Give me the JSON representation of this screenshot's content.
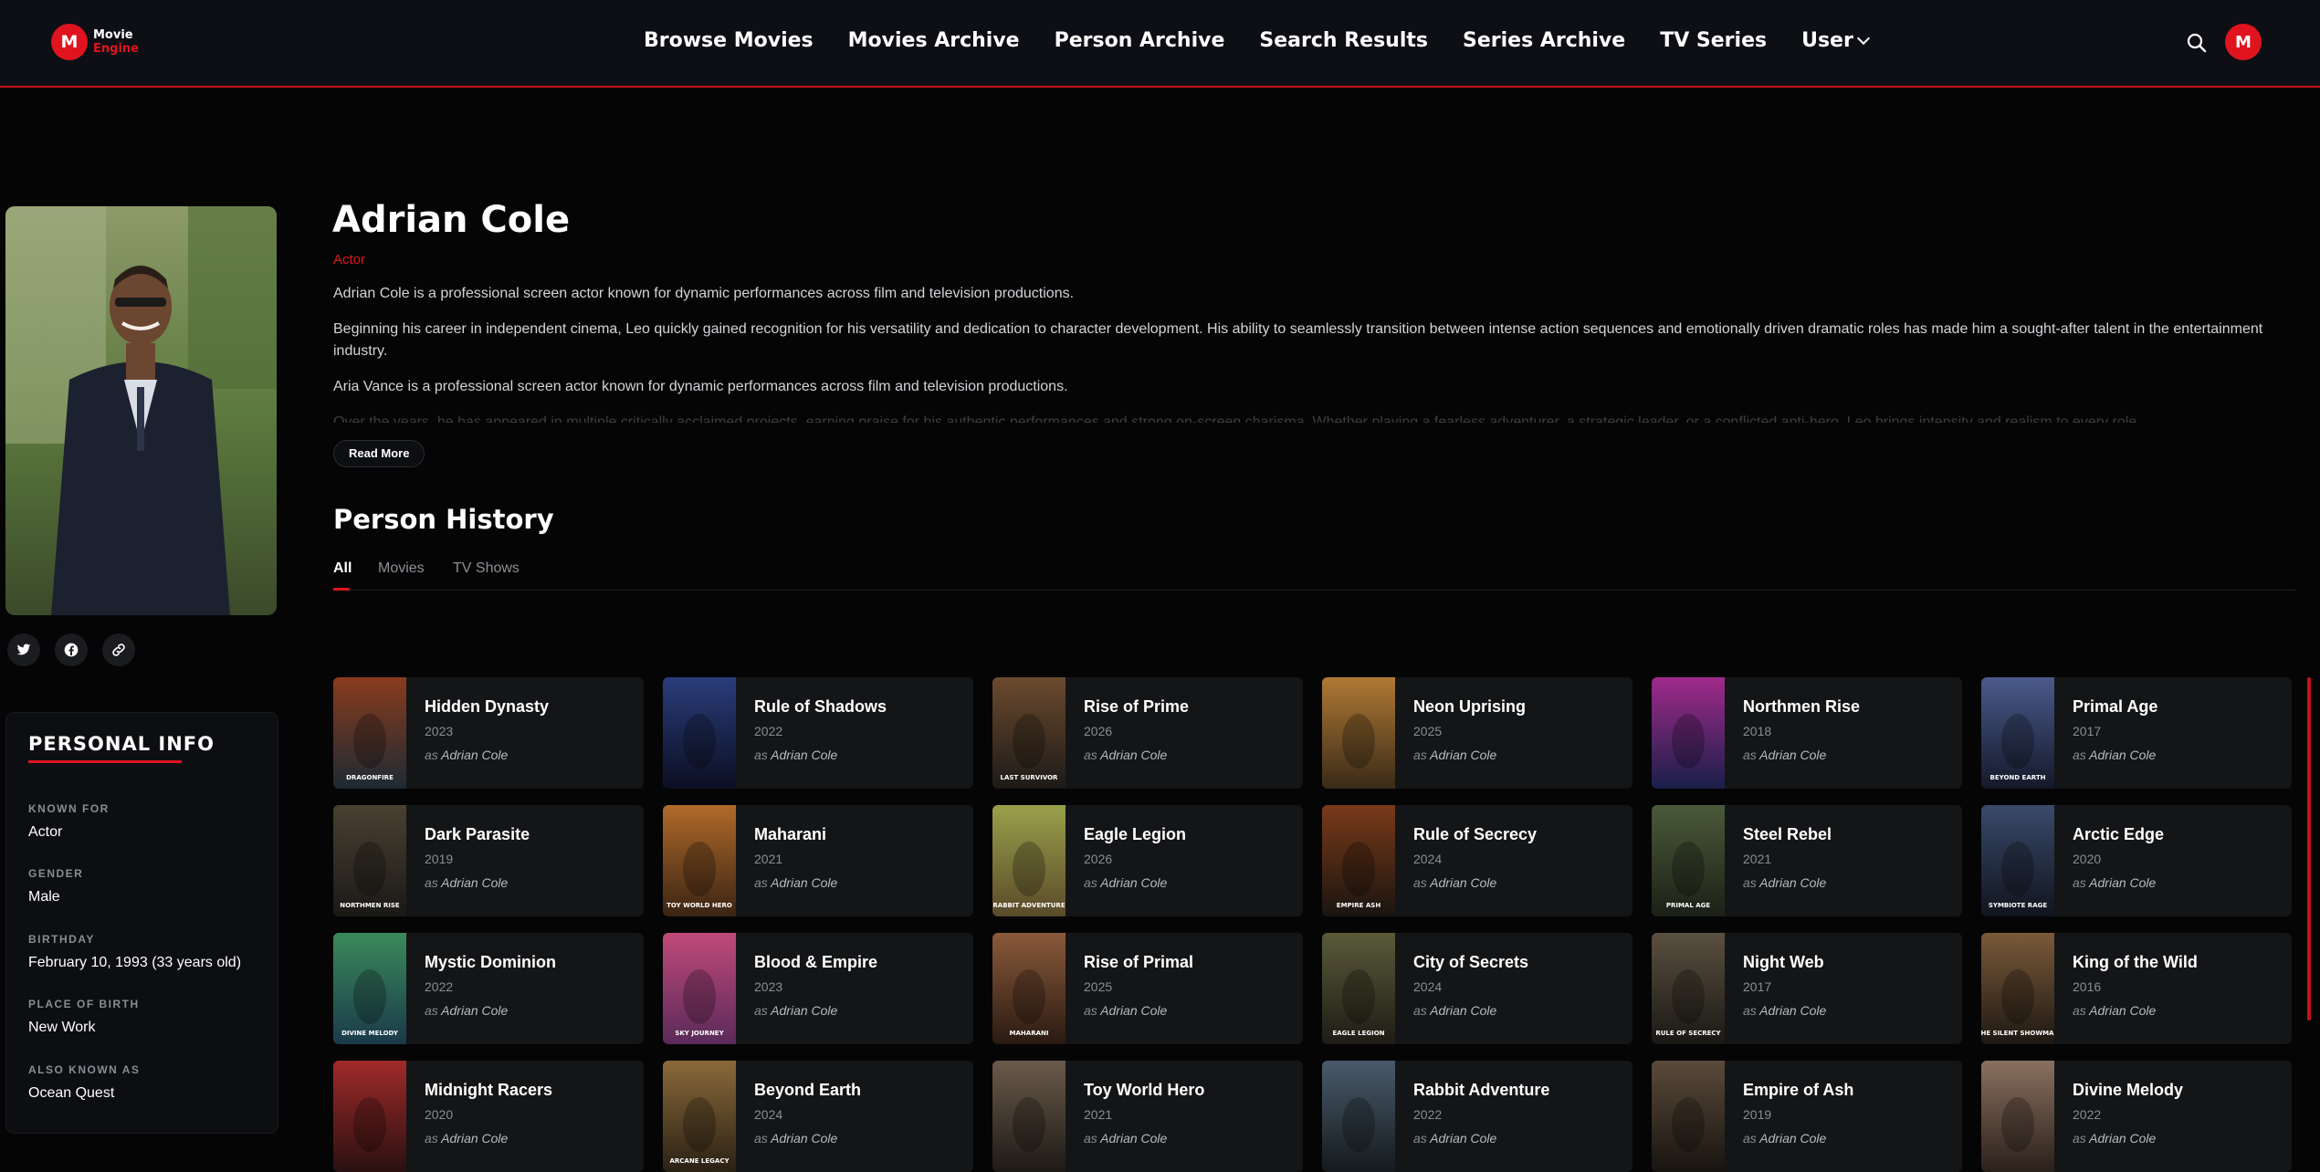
{
  "brand": {
    "badge": "M",
    "line1": "Movie",
    "line2": "Engine",
    "accent": "#e0141e"
  },
  "nav": {
    "items": [
      "Browse Movies",
      "Movies Archive",
      "Person Archive",
      "Search Results",
      "Series Archive",
      "TV Series"
    ],
    "user_label": "User",
    "search_icon": "search-icon",
    "avatar_initial": "M"
  },
  "person": {
    "name": "Adrian Cole",
    "role": "Actor",
    "bio": [
      "Adrian Cole is a professional screen actor known for dynamic performances across film and television productions.",
      "Beginning his career in independent cinema, Leo quickly gained recognition for his versatility and dedication to character development. His ability to seamlessly transition between intense action sequences and emotionally driven dramatic roles has made him a sought-after talent in the entertainment industry.",
      "Aria Vance is a professional screen actor known for dynamic performances across film and television productions.",
      "Over the years, he has appeared in multiple critically acclaimed projects, earning praise for his authentic performances and strong on-screen charisma. Whether playing a fearless adventurer, a strategic leader, or a conflicted anti-hero, Leo brings intensity and realism to every role."
    ],
    "read_more": "Read More",
    "social": [
      "twitter-icon",
      "facebook-icon",
      "link-icon"
    ]
  },
  "personal_info": {
    "title": "PERSONAL INFO",
    "items": [
      {
        "label": "KNOWN FOR",
        "value": "Actor"
      },
      {
        "label": "GENDER",
        "value": "Male"
      },
      {
        "label": "BIRTHDAY",
        "value": "February 10, 1993 (33 years old)"
      },
      {
        "label": "PLACE OF BIRTH",
        "value": "New Work"
      },
      {
        "label": "ALSO KNOWN AS",
        "value": "Ocean Quest"
      }
    ]
  },
  "history": {
    "title": "Person History",
    "tabs": [
      "All",
      "Movies",
      "TV Shows"
    ],
    "role_prefix": "as",
    "role_name": "Adrian Cole",
    "items": [
      {
        "title": "Hidden Dynasty",
        "year": "2023",
        "poster_text": "DRAGONFIRE",
        "c1": "#8a3b1e",
        "c2": "#1e2a33"
      },
      {
        "title": "Rule of Shadows",
        "year": "2022",
        "poster_text": "",
        "c1": "#2a3d7a",
        "c2": "#0c0f22"
      },
      {
        "title": "Rise of Prime",
        "year": "2026",
        "poster_text": "LAST SURVIVOR",
        "c1": "#6b4a2e",
        "c2": "#1d1a17"
      },
      {
        "title": "Neon Uprising",
        "year": "2025",
        "poster_text": "",
        "c1": "#b07a35",
        "c2": "#3a2a17"
      },
      {
        "title": "Northmen Rise",
        "year": "2018",
        "poster_text": "",
        "c1": "#a02a8a",
        "c2": "#1a1f4a"
      },
      {
        "title": "Primal Age",
        "year": "2017",
        "poster_text": "BEYOND EARTH",
        "c1": "#4a5a8a",
        "c2": "#14182a"
      },
      {
        "title": "Dark Parasite",
        "year": "2019",
        "poster_text": "NORTHMEN RISE",
        "c1": "#4a4032",
        "c2": "#1a1916"
      },
      {
        "title": "Maharani",
        "year": "2021",
        "poster_text": "TOY WORLD HERO",
        "c1": "#b06a2a",
        "c2": "#3a2414"
      },
      {
        "title": "Eagle Legion",
        "year": "2026",
        "poster_text": "RABBIT ADVENTURE",
        "c1": "#9aa04a",
        "c2": "#5a4a2a"
      },
      {
        "title": "Rule of Secrecy",
        "year": "2024",
        "poster_text": "EMPIRE ASH",
        "c1": "#7a3a1a",
        "c2": "#1a1410"
      },
      {
        "title": "Steel Rebel",
        "year": "2021",
        "poster_text": "PRIMAL AGE",
        "c1": "#4a5a3a",
        "c2": "#1c2016"
      },
      {
        "title": "Arctic Edge",
        "year": "2020",
        "poster_text": "SYMBIOTE RAGE",
        "c1": "#3a4a6a",
        "c2": "#10141e"
      },
      {
        "title": "Mystic Dominion",
        "year": "2022",
        "poster_text": "DIVINE MELODY",
        "c1": "#3a8a5a",
        "c2": "#1a3a4a"
      },
      {
        "title": "Blood & Empire",
        "year": "2023",
        "poster_text": "SKY JOURNEY",
        "c1": "#c04a7a",
        "c2": "#5a2a5a"
      },
      {
        "title": "Rise of Primal",
        "year": "2025",
        "poster_text": "MAHARANI",
        "c1": "#8a5a3a",
        "c2": "#2a1a12"
      },
      {
        "title": "City of Secrets",
        "year": "2024",
        "poster_text": "EAGLE LEGION",
        "c1": "#5a5a3a",
        "c2": "#1e1c14"
      },
      {
        "title": "Night Web",
        "year": "2017",
        "poster_text": "RULE OF SECRECY",
        "c1": "#5a5040",
        "c2": "#1a1814"
      },
      {
        "title": "King of the Wild",
        "year": "2016",
        "poster_text": "THE SILENT SHOWMAN",
        "c1": "#7a5a3a",
        "c2": "#1e1812"
      },
      {
        "title": "Midnight Racers",
        "year": "2020",
        "poster_text": "",
        "c1": "#a02a2a",
        "c2": "#2a1010"
      },
      {
        "title": "Beyond Earth",
        "year": "2024",
        "poster_text": "ARCANE LEGACY",
        "c1": "#8a6a3a",
        "c2": "#2a2014"
      },
      {
        "title": "Toy World Hero",
        "year": "2021",
        "poster_text": "",
        "c1": "#6a5a4a",
        "c2": "#1e1a16"
      },
      {
        "title": "Rabbit Adventure",
        "year": "2022",
        "poster_text": "",
        "c1": "#4a5a6a",
        "c2": "#141a1e"
      },
      {
        "title": "Empire of Ash",
        "year": "2019",
        "poster_text": "",
        "c1": "#5a4a3a",
        "c2": "#181410"
      },
      {
        "title": "Divine Melody",
        "year": "2022",
        "poster_text": "",
        "c1": "#8a7060",
        "c2": "#2a201a"
      }
    ]
  }
}
